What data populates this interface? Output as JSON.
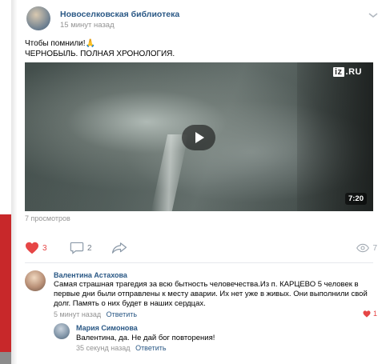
{
  "post": {
    "author": "Новоселковская библиотека",
    "time": "15 минут назад",
    "text_line1": "Чтобы помнили!",
    "pray_emoji": "🙏",
    "text_line2": "ЧЕРНОБЫЛЬ. ПОЛНАЯ ХРОНОЛОГИЯ."
  },
  "video": {
    "watermark_box": "iz",
    "watermark_rest": ".RU",
    "duration": "7:20"
  },
  "views_text": "7 просмотров",
  "actions": {
    "likes": "3",
    "comments": "2",
    "views": "7"
  },
  "comments": [
    {
      "author": "Валентина Астахова",
      "text": "Самая страшная трагедия за всю бытность человечества.Из п. КАРЦЕВО 5 человек в первые дни были отправлены к месту аварии. Их нет уже в живых. Они выполнили свой долг. Память о них будет в наших сердцах.",
      "time": "5 минут назад",
      "reply_label": "Ответить",
      "likes": "1"
    }
  ],
  "replies": [
    {
      "author": "Мария Симонова",
      "text": "Валентина, да. Не дай бог повторения!",
      "time": "35 секунд назад",
      "reply_label": "Ответить"
    }
  ],
  "colors": {
    "link": "#2a5885",
    "like_red": "#e64646",
    "meta_gray": "#939393",
    "side_red": "#c8282a"
  }
}
